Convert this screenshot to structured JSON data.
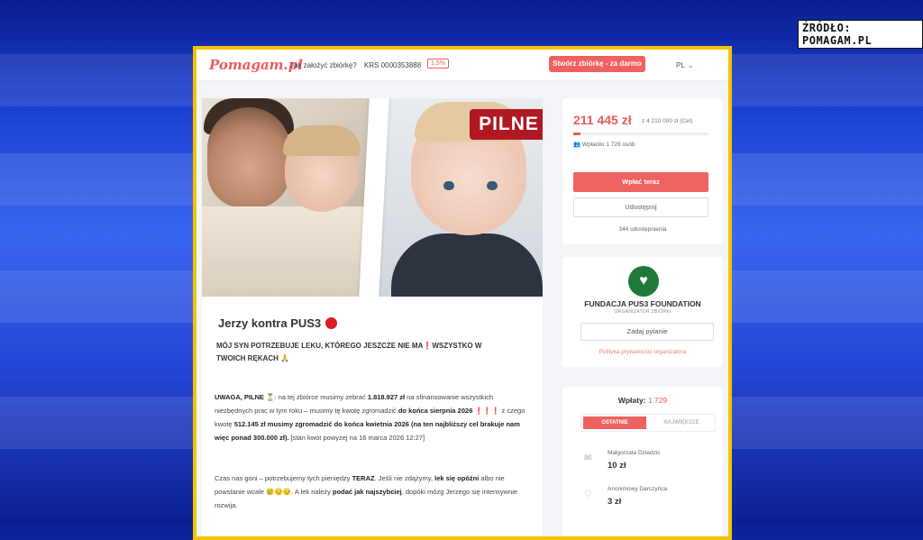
{
  "source_label": "ŹRÓDŁO: POMAGAM.PL",
  "topbar": {
    "logo": "Pomagam.pl",
    "how_to": "Jak założyć zbiórkę?",
    "krs": "KRS 0000353888",
    "percent_badge": "1,5%",
    "create_button": "Stwórz zbiórkę - za darmo",
    "lang": "PL",
    "lang_chevron": "⌄"
  },
  "hero": {
    "badge": "PILNE"
  },
  "campaign": {
    "title": "Jerzy kontra PUS3",
    "subtitle": "MÓJ SYN POTRZEBUJE LEKU, KTÓREGO JESZCZE NIE MA❗WSZYSTKO W TWOICH RĘKACH 🙏",
    "p1": {
      "s1": "UWAGA, PILNE ⏳",
      "s2": ": na tej zbiórce musimy zebrać ",
      "s3": "1.818.927 zł",
      "s4": " na sfinansowanie wszystkich niezbędnych prac w tym roku – musimy tę kwotę zgromadzić ",
      "s5": "do końca sierpnia 2026 ❗❗❗",
      "s6": " z czego kwotę ",
      "s7": "512.145 zł musimy zgromadzić do końca kwietnia 2026 (na ten najbliższy cel brakuje nam więc ponad 300.000 zł).",
      "s8": "  [stan kwot powyżej na 16 marca 2026 12:27]"
    },
    "p2": {
      "s1": "Czas nas goni – potrzebujemy tych pieniędzy ",
      "s2": "TERAZ",
      "s3": ". Jeśli nie zdążymy, ",
      "s4": "lek się opóźni",
      "s5": " albo nie powstanie wcale 😢😔😔. A lek należy ",
      "s6": "podać jak najszybciej",
      "s7": ", dopóki mózg Jerzego się intensywnie rozwija."
    }
  },
  "fundraiser": {
    "amount": "211 445 zł",
    "goal": "z 4 210 000 zł (Cel)",
    "progress_fraction": 0.05,
    "payers": "Wpłaciło 1 729 osób",
    "pay_button": "Wpłać teraz",
    "share_button": "Udostępnij",
    "shares": "344 udostępnienia"
  },
  "organizer": {
    "logo_icon": "♥",
    "name": "FUNDACJA PUS3 FOUNDATION",
    "role": "ORGANIZATOR ZBIÓRKI",
    "ask_button": "Zadaj pytanie",
    "privacy": "Polityka prywatności organizatora"
  },
  "donations": {
    "title": "Wpłaty:",
    "count": "1 729",
    "tab_recent": "OSTATNIE",
    "tab_largest": "NAJWIĘKSZE",
    "items": [
      {
        "icon": "✉",
        "name": "Małgorzata Dziedzic",
        "amount": "10 zł"
      },
      {
        "icon": "♡",
        "name": "Anonimowy Darczyńca",
        "amount": "3 zł"
      }
    ]
  }
}
